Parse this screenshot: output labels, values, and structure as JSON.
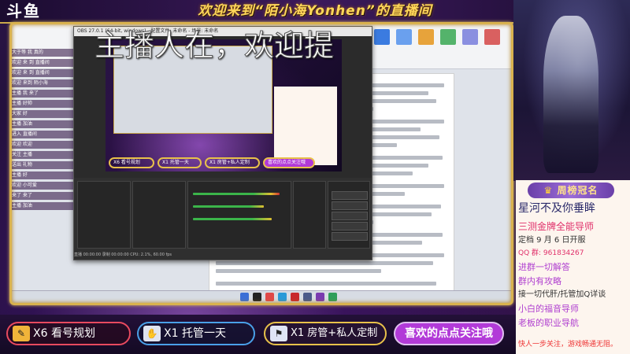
{
  "banner": {
    "logo": "斗鱼",
    "welcome": "欢迎来到“陌小海Yonhen”的直播间"
  },
  "overlay": {
    "text": "主播人在，欢迎提"
  },
  "obs": {
    "title": "OBS 27.0.1 (64-bit, windows) - 配置文件: 未命名 - 场景: 未命名",
    "status": "直播 00:00:00   录制 00:00:00   CPU: 2.1%, 60.00 fps"
  },
  "chat": {
    "lines": [
      "大于等 我 真的",
      "欢迎 来 到 直播间",
      "欢迎 来 到 直播间",
      "欢迎 来到 陌小海",
      "主播 我 来了",
      "主播 好帅",
      "大家 好",
      "主播 加油",
      "进入 直播间",
      "欢迎 欢迎",
      "关注 主播",
      "送出 礼物",
      "主播 好",
      "欢迎 小可爱",
      "来了 来了",
      "主播 加油"
    ]
  },
  "rank": {
    "title": "周榜冠名",
    "top_name": "星河不及你垂眸",
    "lines": [
      {
        "text": "三测金牌全能导师",
        "color": "#e0306a",
        "size": 12
      },
      {
        "text": "定档 9 月 6 日开服",
        "color": "#333333",
        "size": 10
      },
      {
        "text": "QQ 群: 961834267",
        "color": "#e0306a",
        "size": 9
      },
      {
        "text": "进群一切解答",
        "color": "#b040d0",
        "size": 11
      },
      {
        "text": "群内有攻略",
        "color": "#b040d0",
        "size": 11
      },
      {
        "text": "接一切代肝/托管加Q详谈",
        "color": "#333333",
        "size": 10
      },
      {
        "text": "小白的福音导师",
        "color": "#b040d0",
        "size": 11
      },
      {
        "text": "老板的职业导航",
        "color": "#b040d0",
        "size": 11
      }
    ],
    "footer": "快人一步关注，游戏畅通无阻。"
  },
  "buttons": [
    {
      "label": "X6 看号规划",
      "icon": "ticket-icon",
      "glyph": "✎"
    },
    {
      "label": "X1 托管一天",
      "icon": "hand-icon",
      "glyph": "✋"
    },
    {
      "label": "X1 房管+私人定制",
      "icon": "flag-icon",
      "glyph": "⚑"
    },
    {
      "label": "喜欢的点点关注哦",
      "icon": "",
      "glyph": ""
    }
  ],
  "preview_buttons": [
    {
      "label": "X6 看号规划"
    },
    {
      "label": "X1 托管一天"
    },
    {
      "label": "X1 房管+私人定制"
    },
    {
      "label": "喜欢的点点关注哦"
    }
  ]
}
